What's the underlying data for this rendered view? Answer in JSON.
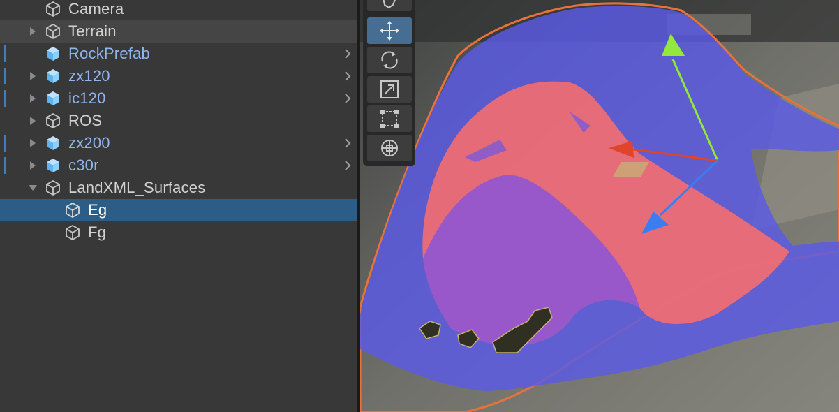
{
  "hierarchy": {
    "items": [
      {
        "label": "Camera",
        "type": "object"
      },
      {
        "label": "Terrain",
        "type": "object"
      },
      {
        "label": "RockPrefab",
        "type": "prefab"
      },
      {
        "label": "zx120",
        "type": "prefab"
      },
      {
        "label": "ic120",
        "type": "prefab"
      },
      {
        "label": "ROS",
        "type": "object"
      },
      {
        "label": "zx200",
        "type": "prefab"
      },
      {
        "label": "c30r",
        "type": "prefab"
      },
      {
        "label": "LandXML_Surfaces",
        "type": "object"
      },
      {
        "label": "Eg",
        "type": "object",
        "selected": true
      },
      {
        "label": "Fg",
        "type": "object"
      }
    ]
  },
  "tools": {
    "items": [
      "hand-tool",
      "move-tool",
      "rotate-tool",
      "scale-tool",
      "rect-tool",
      "transform-tool"
    ],
    "active": "move-tool"
  },
  "colors": {
    "panel_bg": "#383838",
    "selection": "#2c5d87",
    "prefab_text": "#8fb6f0",
    "surface_blue": "#5a5ae6",
    "surface_red": "#ff6f6a",
    "gizmo_x": "#e0442a",
    "gizmo_y": "#93e83c",
    "gizmo_z": "#3c7cf0"
  }
}
